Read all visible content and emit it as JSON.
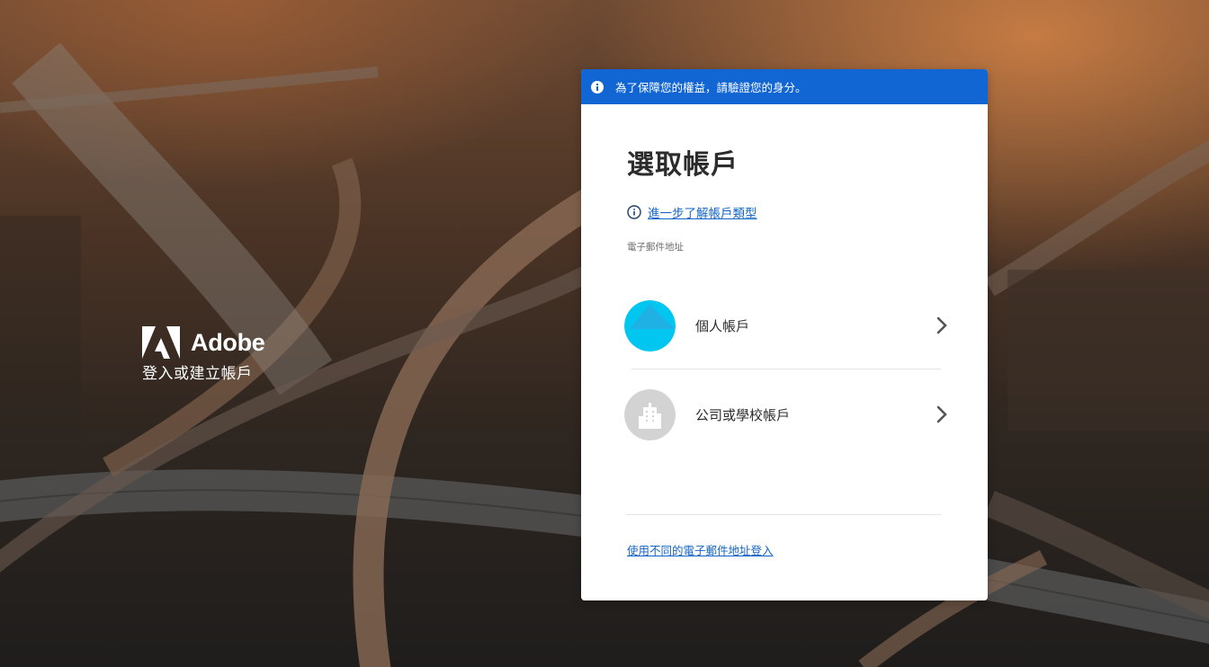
{
  "brand": {
    "name": "Adobe",
    "subtitle": "登入或建立帳戶"
  },
  "banner": {
    "icon": "info-icon",
    "text": "為了保障您的權益，請驗證您的身分。"
  },
  "card": {
    "title": "選取帳戶",
    "learn_more": "進一步了解帳戶類型",
    "email_label": "電子郵件地址",
    "accounts": [
      {
        "label": "個人帳戶",
        "icon": "personal-avatar-icon"
      },
      {
        "label": "公司或學校帳戶",
        "icon": "building-icon"
      }
    ],
    "other_email_link": "使用不同的電子郵件地址登入"
  },
  "colors": {
    "banner": "#1266d4",
    "link": "#1264c8",
    "personal_avatar": "#00c6f0",
    "business_avatar": "#d3d3d3"
  }
}
